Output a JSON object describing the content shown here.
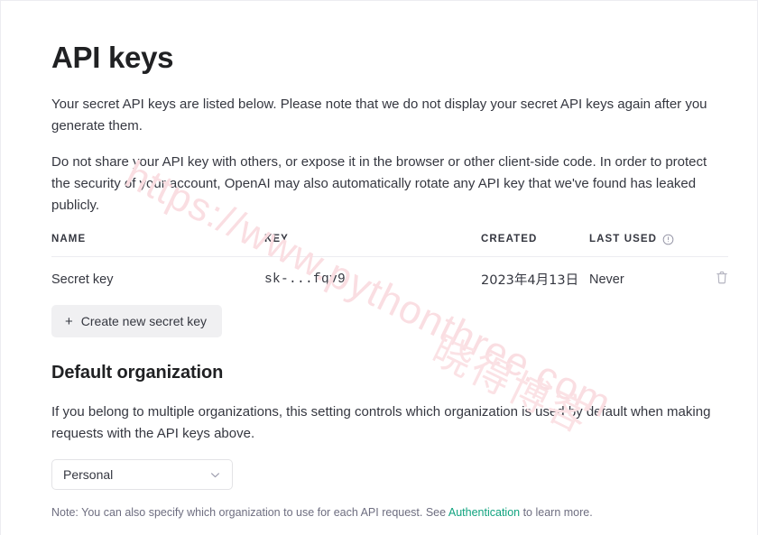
{
  "page": {
    "title": "API keys"
  },
  "descriptions": {
    "secret_keys": "Your secret API keys are listed below. Please note that we do not display your secret API keys again after you generate them.",
    "do_not_share": "Do not share your API key with others, or expose it in the browser or other client-side code. In order to protect the security of your account, OpenAI may also automatically rotate any API key that we've found has leaked publicly."
  },
  "table": {
    "columns": [
      {
        "key": "name",
        "label": "NAME"
      },
      {
        "key": "key",
        "label": "KEY"
      },
      {
        "key": "created",
        "label": "CREATED"
      },
      {
        "key": "last_used",
        "label": "LAST USED",
        "info_icon": "info-circle-icon"
      },
      {
        "key": "actions",
        "label": ""
      }
    ],
    "rows": [
      {
        "name": "Secret key",
        "key": "sk-...fqv9",
        "created": "2023年4月13日",
        "last_used": "Never",
        "delete_icon": "trash-icon"
      }
    ]
  },
  "actions": {
    "create_key_plus": "+",
    "create_key_label": "Create new secret key"
  },
  "organization": {
    "heading": "Default organization",
    "description": "If you belong to multiple organizations, this setting controls which organization is used by default when making requests with the API keys above.",
    "selected": "Personal",
    "options": [
      "Personal"
    ],
    "chevron_icon": "chevron-down-icon",
    "note_prefix": "Note: You can also specify which organization to use for each API request. See ",
    "note_link": "Authentication",
    "note_suffix": " to learn more."
  },
  "watermarks": {
    "url": "https://www.pythonthree.com",
    "brand": "晓得博客"
  },
  "colors": {
    "accent_green": "#10a37f",
    "text_primary": "#202123",
    "text_body": "#353740",
    "text_muted": "#6e6e80",
    "border": "#ececf1",
    "button_bg": "#f0f0f2",
    "watermark_pink": "#fadee2"
  }
}
